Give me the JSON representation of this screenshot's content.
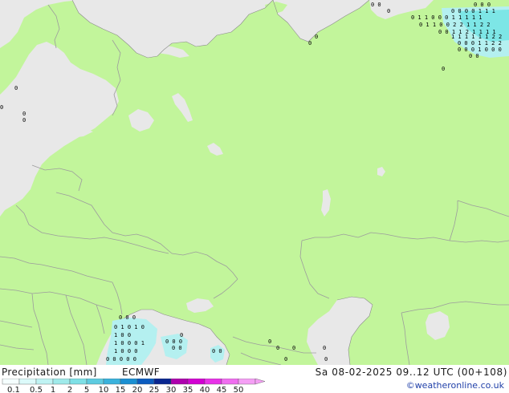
{
  "map": {
    "colors": {
      "sea": "#e8e8e8",
      "land": "#c2f59b",
      "border": "#9c9c9c",
      "coast": "#8a8a8a",
      "precip_light": "#b4f0f0",
      "precip_medium": "#7de6e6"
    }
  },
  "legend": {
    "title": "Precipitation [mm]",
    "model": "ECMWF",
    "ticks": [
      "0.1",
      "0.5",
      "1",
      "2",
      "5",
      "10",
      "15",
      "20",
      "25",
      "30",
      "35",
      "40",
      "45",
      "50"
    ],
    "colors": [
      "#f5fefe",
      "#dcfafa",
      "#bff3f3",
      "#9feaea",
      "#7ee0e6",
      "#5dcbe0",
      "#3ab2dc",
      "#1b8fd2",
      "#0c5cbf",
      "#09268f",
      "#ad00ad",
      "#d200d2",
      "#e832e8",
      "#f06ef0",
      "#f59ff5"
    ]
  },
  "valid_time": "Sa 08-02-2025 09..12 UTC (00+108)",
  "credit": "©weatheronline.co.uk"
}
